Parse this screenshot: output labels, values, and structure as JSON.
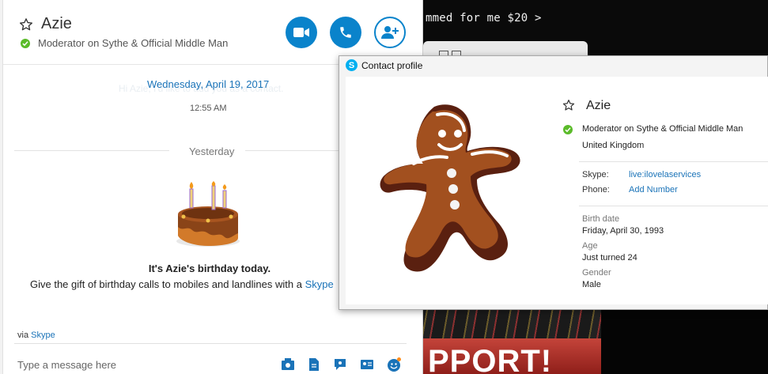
{
  "background": {
    "promo_text": "mmed for me $20 >",
    "photo_text": "PPORT!"
  },
  "header": {
    "contact_name": "Azie",
    "mood": "Moderator on Sythe & Official Middle Man"
  },
  "conversation": {
    "date_link": "Wednesday, April 19, 2017",
    "ghost_message": "Hi Azie, I'd like to add you as a contact.",
    "time": "12:55 AM",
    "separator_label": "Yesterday",
    "birthday_title": "It's Azie's birthday today.",
    "birthday_text": "Give the gift of birthday calls to mobiles and landlines with a",
    "birthday_link": "Skype",
    "via_prefix": "via",
    "via_link": "Skype"
  },
  "composer": {
    "placeholder": "Type a message here"
  },
  "profile": {
    "window_title": "Contact profile",
    "name": "Azie",
    "mood": "Moderator on Sythe & Official Middle Man",
    "country": "United Kingdom",
    "skype_label": "Skype:",
    "skype_value": "live:ilovelaservices",
    "phone_label": "Phone:",
    "phone_value": "Add Number",
    "birth_date_label": "Birth date",
    "birth_date_value": "Friday, April 30, 1993",
    "age_label": "Age",
    "age_value": "Just turned 24",
    "gender_label": "Gender",
    "gender_value": "Male"
  },
  "colors": {
    "skype_blue": "#0a83cb",
    "online_green": "#5bbb2a",
    "link_blue": "#1a73b8"
  }
}
